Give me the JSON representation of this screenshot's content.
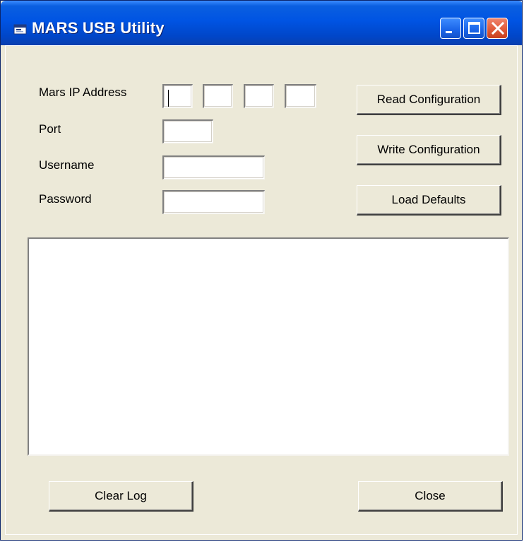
{
  "window": {
    "title": "MARS USB Utility",
    "title_bar_color": "#0054e3",
    "close_button_color": "#e05a3a",
    "background_color": "#ece9d8"
  },
  "form": {
    "ip_label": "Mars IP Address",
    "ip_octets": [
      "",
      "",
      "",
      ""
    ],
    "port_label": "Port",
    "port_value": "",
    "username_label": "Username",
    "username_value": "",
    "password_label": "Password",
    "password_value": ""
  },
  "buttons": {
    "read_config": "Read Configuration",
    "write_config": "Write Configuration",
    "load_defaults": "Load Defaults",
    "clear_log": "Clear Log",
    "close": "Close"
  },
  "log": {
    "content": ""
  }
}
